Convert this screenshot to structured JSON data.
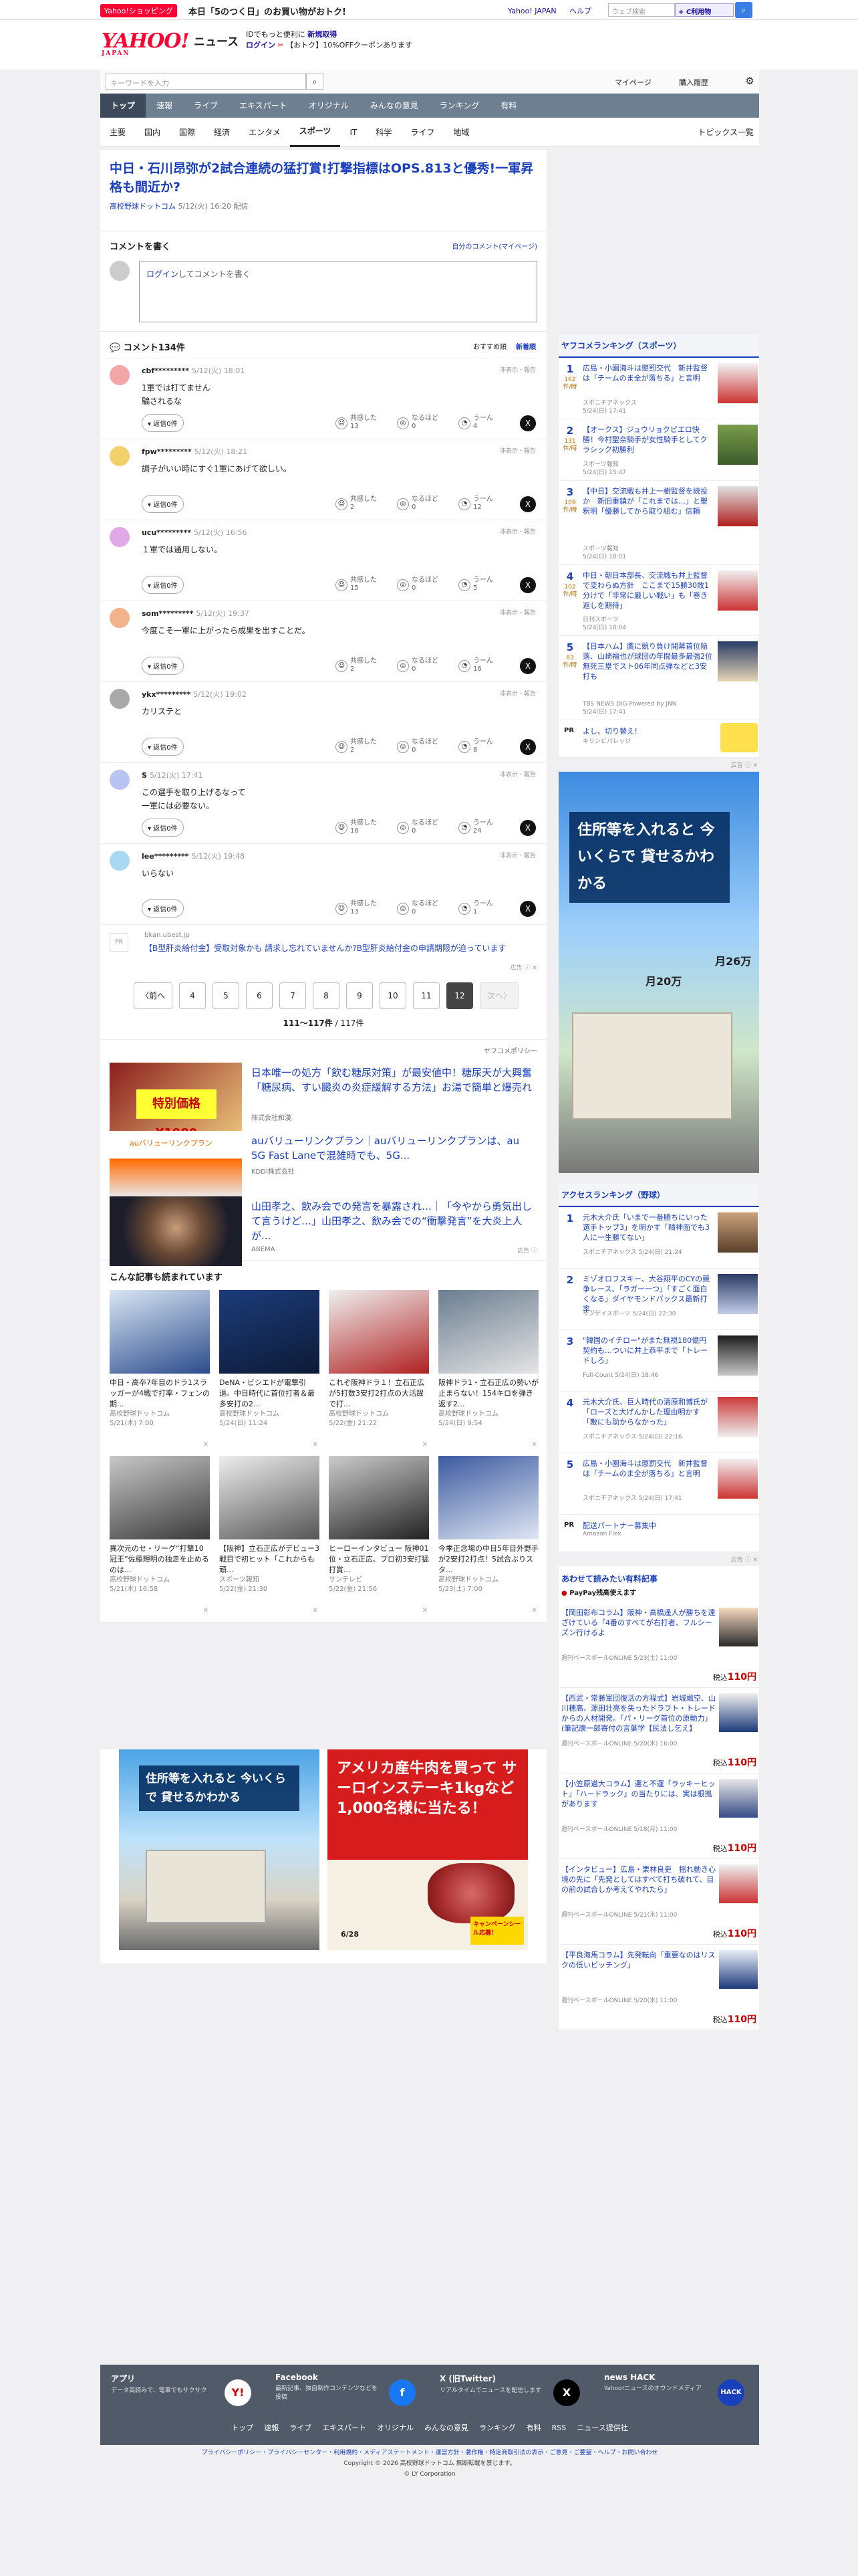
{
  "topbar": {
    "shop": "Yahoo!ショッピング",
    "promo": "本日「5のつく日」のお買い物がおトク!",
    "links": [
      "Yahoo! JAPAN",
      "ヘルプ"
    ],
    "search_placeholder": "ウェブ検索",
    "search_btn": "+ C利用物"
  },
  "header": {
    "logo": "YAHOO!",
    "logo_sub": "JAPAN",
    "service": "ニュース",
    "id_line1a": "IDでもっと便利に",
    "id_line1b": "新規取得",
    "id_login": "ログイン",
    "id_line2": "【おトク】10%OFFクーポンあります"
  },
  "search": {
    "placeholder": "キーワードを入力",
    "mypage": "マイページ",
    "history": "購入履歴"
  },
  "nav": [
    "トップ",
    "速報",
    "ライブ",
    "エキスパート",
    "オリジナル",
    "みんなの意見",
    "ランキング",
    "有料"
  ],
  "subnav": [
    "主要",
    "国内",
    "国際",
    "経済",
    "エンタメ",
    "スポーツ",
    "IT",
    "科学",
    "ライフ",
    "地域"
  ],
  "subnav_topics": "トピックス一覧",
  "article": {
    "title": "中日・石川昂弥が2試合連続の猛打賞!打撃指標はOPS.813と優秀!一軍昇格も間近か?",
    "source": "高校野球ドットコム",
    "date": "5/12(火) 16:20 配信"
  },
  "comment_form": {
    "title": "コメントを書く",
    "mine": "自分のコメント(マイページ)",
    "login": "ログイン",
    "placeholder_rest": "してコメントを書く"
  },
  "comments_header": {
    "title": "コメント134件",
    "sort_recommended": "おすすめ順",
    "sort_new": "新着順"
  },
  "reaction_labels": {
    "agree": "共感した",
    "naruhodo": "なるほど",
    "uun": "うーん"
  },
  "reply_label": "返信0件",
  "report_label": "非表示・報告",
  "comments": [
    {
      "user": "cbf*********",
      "time": "5/12(火) 18:01",
      "text": "1軍では打てません\n騙されるな",
      "agree": "13",
      "naru": "0",
      "uun": "4",
      "color": "#f4a6a6"
    },
    {
      "user": "fpw*********",
      "time": "5/12(火) 18:21",
      "text": "調子がいい時にすぐ1軍にあげて欲しい。",
      "agree": "2",
      "naru": "0",
      "uun": "12",
      "color": "#f2d16b"
    },
    {
      "user": "ucu*********",
      "time": "5/12(火) 16:56",
      "text": "１軍では通用しない。",
      "agree": "15",
      "naru": "0",
      "uun": "5",
      "color": "#e0a8e6"
    },
    {
      "user": "som*********",
      "time": "5/12(火) 19:37",
      "text": "今度こそ一軍に上がったら成果を出すことだ。",
      "agree": "2",
      "naru": "0",
      "uun": "16",
      "color": "#f2b38a"
    },
    {
      "user": "ykx*********",
      "time": "5/12(火) 19:02",
      "text": "カリステと",
      "agree": "2",
      "naru": "0",
      "uun": "8",
      "color": "#a9a9a9"
    },
    {
      "user": "S",
      "time": "5/12(火) 17:41",
      "text": "この選手を取り上げるなって\n一軍には必要ない。",
      "agree": "18",
      "naru": "0",
      "uun": "24",
      "color": "#b9c4f2"
    },
    {
      "user": "lee*********",
      "time": "5/12(火) 19:48",
      "text": "いらない",
      "agree": "13",
      "naru": "0",
      "uun": "1",
      "color": "#a9d8f2"
    }
  ],
  "inline_ad": {
    "pr": "PR",
    "domain": "bkan.ubest.jp",
    "text": "【B型肝炎給付金】受取対象かも 請求し忘れていませんか?B型肝炎給付金の申請期限が迫っています",
    "mark": "広告"
  },
  "pager": {
    "prev": "〈前へ",
    "pages": [
      "4",
      "5",
      "6",
      "7",
      "8",
      "9",
      "10",
      "11",
      "12"
    ],
    "current": "12",
    "next": "次へ〉",
    "range": "111〜117件",
    "total": "/ 117件"
  },
  "ad_block": {
    "policy": "ヤフコメポリシー",
    "mark": "広告",
    "items": [
      {
        "title": "日本唯一の処方「飲む糖尿対策」が最安値中！糖尿天が大興奮「糖尿病、すい臓炎の炎症緩解する方法」お湯で簡単と爆売れ",
        "sponsor": "株式会社和漢",
        "thumb_text": "特別価格 ¥1980"
      },
      {
        "title": "auバリューリンクプラン｜auバリューリンクプランは、au 5G Fast Laneで混雑時でも、5G...",
        "sponsor": "KDDI株式会社",
        "thumb_text": "auバリューリンクプラン"
      },
      {
        "title": "山田孝之、飲み会での発言を暴露され…｜「今やから勇気出して言うけど…」山田孝之、飲み会での“衝撃発言”を大炎上人が...",
        "sponsor": "ABEMA",
        "thumb_text": ""
      }
    ]
  },
  "also_read": {
    "title": "こんな記事も読まれています",
    "cards": [
      {
        "title": "中日・高卒7年目のドラ1スラッガーが4戦で打率・フェンの期...",
        "source": "高校野球ドットコム",
        "time": "5/21(木) 7:00"
      },
      {
        "title": "DeNA・ビシエドが電撃引退。中日時代に首位打者＆最多安打の2...",
        "source": "高校野球ドットコム",
        "time": "5/24(日) 11:24"
      },
      {
        "title": "これぞ阪神ドラ１！立石正広が5打数3安打2打点の大活躍で打...",
        "source": "高校野球ドットコム",
        "time": "5/22(金) 21:22"
      },
      {
        "title": "阪神ドラ1・立石正広の勢いが止まらない！154キロを弾き返す2...",
        "source": "高校野球ドットコム",
        "time": "5/24(日) 9:54"
      },
      {
        "title": "異次元のセ・リーグ“打撃10冠王”佐藤輝明の独走を止めるのは...",
        "source": "高校野球ドットコム",
        "time": "5/21(木) 16:58"
      },
      {
        "title": "【阪神】立石正広がデビュー3戦目で初ヒット「これからも頑...",
        "source": "スポーツ報知",
        "time": "5/22(金) 21:30"
      },
      {
        "title": "ヒーローインタビュー 阪神01位・立石正広、プロ初3安打猛打賞...",
        "source": "サンテレビ",
        "time": "5/22(金) 21:56"
      },
      {
        "title": "今季正念場の中日5年目外野手が2安打2打点！5試合ぶりスタ...",
        "source": "高校野球ドットコム",
        "time": "5/23(土) 7:00"
      }
    ]
  },
  "big_ads": [
    {
      "headline": "住所等を入れると 今いくらで 貸せるかわかる"
    },
    {
      "headline": "アメリカ産牛肉を買って サーロインステーキ1kgなど 1,000名様に当たる！",
      "badge": "キャンペーンシール応募！",
      "date": "6/28"
    }
  ],
  "ranking_sports": {
    "title": "ヤフコメランキング（スポーツ）",
    "unit": "件/時",
    "items": [
      {
        "no": "1",
        "count": "162",
        "title": "広島・小園海斗は懲罰交代　新井監督は「チームのま全が落ちる」と言明",
        "source": "スポニチアネックス",
        "time": "5/24(日) 17:41"
      },
      {
        "no": "2",
        "count": "131",
        "title": "【オークス】ジュウリョクピエロ快勝！今村聖奈騎手が女性騎手としてクラシック初勝利",
        "source": "スポーツ報知",
        "time": "5/24(日) 15:47"
      },
      {
        "no": "3",
        "count": "109",
        "title": "【中日】交流戦も井上一樹監督を続投か　新旧重鎮が「これまでは…」と聖釈明「優勝してから取り組む」信頼",
        "source": "スポーツ報知",
        "time": "5/24(日) 18:01"
      },
      {
        "no": "4",
        "count": "102",
        "title": "中日・朝日本部長、交流戦も井上監督で変わらぬ方針　ここまで15勝30敗1分けで「非常に厳しい戦い」も「巻き返しを期待」",
        "source": "日刊スポーツ",
        "time": "5/24(日) 18:04"
      },
      {
        "no": "5",
        "count": "83",
        "title": "【日本ハム】鷹に競り負け開幕首位陥落、山崎福也が球団の年間最多最強2位　無死三塁でスト06年同点弾などと3安打も",
        "source": "TBS NEWS DIG Powered by JNN",
        "time": "5/24(日) 17:41"
      }
    ],
    "pr": {
      "label": "PR",
      "title": "よし、切り替え！",
      "sponsor": "キリンビバレッジ"
    }
  },
  "side_ad": {
    "headline": "住所等を入れると 今いくらで 貸せるかわかる",
    "p1": "月20万",
    "p2": "月26万"
  },
  "ranking_access": {
    "title": "アクセスランキング（野球）",
    "items": [
      {
        "no": "1",
        "title": "元木大介氏「いまで一番勝ちにいった選手トップ3」を明かす「精神面でも3人に一生勝てない」",
        "source": "スポニチアネックス",
        "time": "5/24(日) 21:24"
      },
      {
        "no": "2",
        "title": "ミゾオロフスキー、大谷翔平のCYの競争レース、「ラガー一つ」「すごく面白くなる」ダイヤモンドバックス最新打率…",
        "source": "サンデイスポーツ",
        "time": "5/24(日) 22:30"
      },
      {
        "no": "3",
        "title": "\"韓国のイチロー\"がまた無視180億円契約も…ついに井上恭平まで「トレードしろ」",
        "source": "Full-Count",
        "time": "5/24(日) 18:46"
      },
      {
        "no": "4",
        "title": "元木大介氏、巨人時代の清原和博氏が「ローズと大げんかした理由明かす「敵にも助からなかった」",
        "source": "スポニチアネックス",
        "time": "5/24(日) 22:16"
      },
      {
        "no": "5",
        "title": "広島・小園海斗は懲罰交代　新井監督は「チームのま全が落ちる」と言明",
        "source": "スポニチアネックス",
        "time": "5/24(日) 17:41"
      }
    ],
    "pr": {
      "label": "PR",
      "title": "配送パートナー募集中",
      "sponsor": "Amazon Flex"
    }
  },
  "paid": {
    "title": "あわせて読みたい有料記事",
    "paypay": "PayPay残高使えます",
    "price_prefix": "税込",
    "price": "110円",
    "items": [
      {
        "title": "【岡田彰布コラム】阪神・高橋遥人が勝ちを遠ざけている「4番のすべてが右打者、フルシーズン行けるよ",
        "source": "週刊ベースボールONLINE 5/23(土) 11:00"
      },
      {
        "title": "【西武・常勝軍団復活の方程式】岩城颯空、山川穂高、源田壮亮を失ったドラフト・トレードからの人材開発。「パ・リーグ首位の原動力」(筆記康一郎寄付の言葉学【民法し乞え】",
        "source": "週刊ベースボールONLINE 5/20(水) 16:00"
      },
      {
        "title": "【小笠原道大コラム】選と不運「ラッキーヒット」「ハードラック」の当たりには、実は根拠があります",
        "source": "週刊ベースボールONLINE 5/18(月) 11:00"
      },
      {
        "title": "【インタビュー】広島・栗林良吏　揺れ動き心境の先に「先発としてはすべて打ち破れて、目の前の試合しか考えてやれたら」",
        "source": "週刊ベースボールONLINE 5/21(木) 11:00"
      },
      {
        "title": "【平良海馬コラム】先発転向「重要なのはリスクの低いピッチング」",
        "source": "週刊ベースボールONLINE 5/20(水) 11:00"
      }
    ]
  },
  "footer": {
    "cols": [
      {
        "h": "アプリ",
        "d": "データ高読みで、電車でもサクサク",
        "icon": "Y!"
      },
      {
        "h": "Facebook",
        "d": "最新記事、独自制作コンテンツなどを投稿",
        "icon": "f"
      },
      {
        "h": "X (旧Twitter)",
        "d": "リアルタイムでニュースを配信します",
        "icon": "X"
      },
      {
        "h": "news HACK",
        "d": "Yahoo!ニュースのオウンドメディア",
        "icon": "HACK"
      }
    ],
    "links": [
      "トップ",
      "速報",
      "ライブ",
      "エキスパート",
      "オリジナル",
      "みんなの意見",
      "ランキング",
      "有料",
      "RSS",
      "ニュース提供社"
    ],
    "policy": "プライバシーポリシー・プライバシーセンター・利用規約・メディアステートメント・運営方針・著作権・特定商取引法の表示・ご意見・ご要望・ヘルプ・お問い合わせ",
    "copyright1": "Copyright © 2026 高校野球ドットコム 無断転載を禁じます。",
    "copyright2": "© LY Corporation"
  },
  "colors": {
    "brand": "#ff0033",
    "link": "#1a3fbd",
    "nav": "#6e7f92"
  }
}
